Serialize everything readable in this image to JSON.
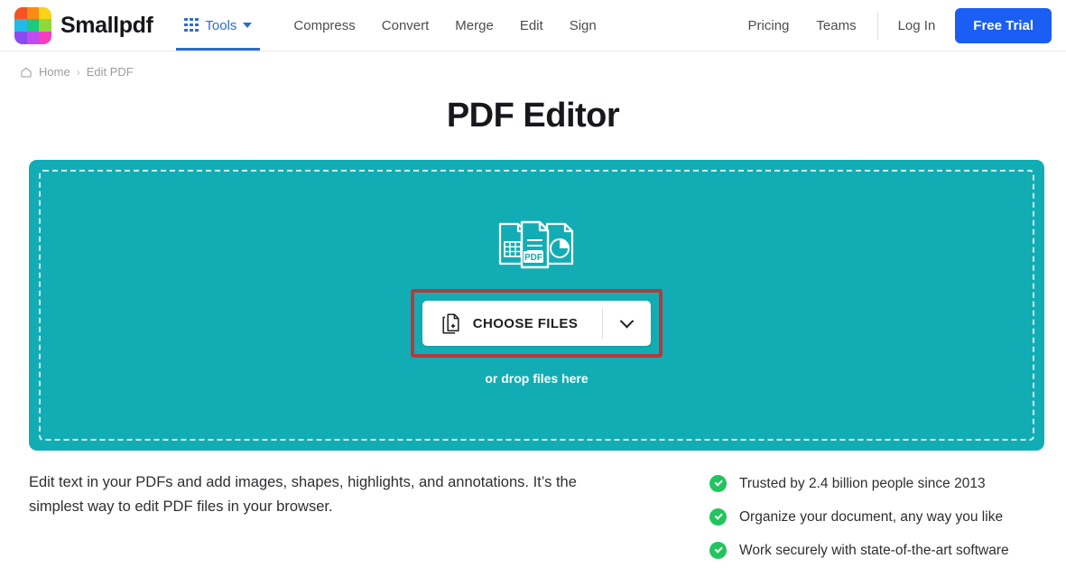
{
  "brand": {
    "name": "Smallpdf",
    "logo_colors": [
      "#f4541f",
      "#fb8a17",
      "#fbd419",
      "#23b9e8",
      "#1ec87f",
      "#8ed93b",
      "#8a4bf0",
      "#c04bf0",
      "#f53fc0"
    ]
  },
  "header": {
    "tools": {
      "label": "Tools",
      "icon": "grid-dots-icon",
      "caret": "chevron-down-icon"
    },
    "nav_links": [
      "Compress",
      "Convert",
      "Merge",
      "Edit",
      "Sign"
    ],
    "secondary_links": [
      "Pricing",
      "Teams"
    ],
    "login_label": "Log In",
    "cta_label": "Free Trial",
    "accent_blue": "#1a5ef5",
    "link_blue": "#2b6cd4"
  },
  "breadcrumb": {
    "home_icon": "home-icon",
    "home_label": "Home",
    "separator": "›",
    "current": "Edit PDF"
  },
  "main": {
    "title": "PDF Editor",
    "dropzone": {
      "background_color": "#12adb4",
      "highlight_color": "#b23b3e",
      "docs_icon": "documents-stack-icon",
      "choose_files_label": "CHOOSE FILES",
      "choose_files_icon": "file-add-icon",
      "dropdown_icon": "chevron-down-icon",
      "drop_hint": "or drop files here"
    },
    "description": "Edit text in your PDFs and add images, shapes, highlights, and annotations. It’s the simplest way to edit PDF files in your browser.",
    "features": [
      "Trusted by 2.4 billion people since 2013",
      "Organize your document, any way you like",
      "Work securely with state-of-the-art software"
    ],
    "feature_icon": "check-circle-icon",
    "feature_color": "#21c45d"
  }
}
